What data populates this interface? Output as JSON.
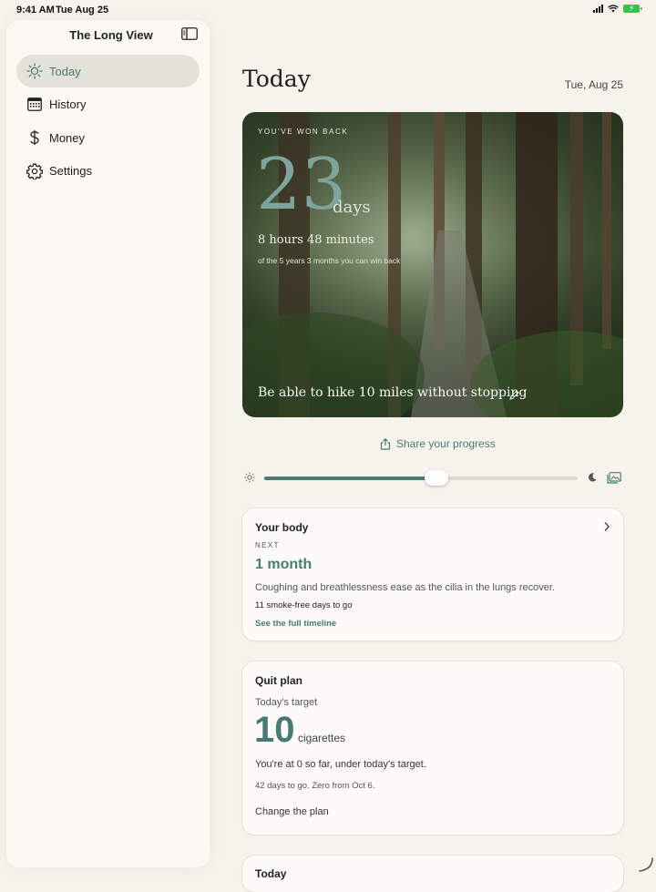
{
  "status_bar": {
    "time": "9:41 AM",
    "date": "Tue Aug 25"
  },
  "sidebar": {
    "app_title": "The Long View",
    "items": [
      {
        "label": "Today",
        "icon": "sun-icon",
        "active": true
      },
      {
        "label": "History",
        "icon": "calendar-icon",
        "active": false
      },
      {
        "label": "Money",
        "icon": "dollar-icon",
        "active": false
      },
      {
        "label": "Settings",
        "icon": "gear-icon",
        "active": false
      }
    ]
  },
  "main": {
    "title": "Today",
    "date": "Tue, Aug 25",
    "hero": {
      "kicker": "YOU'VE WON BACK",
      "number": "23",
      "unit": "days",
      "sub": "8 hours 48 minutes",
      "note": "of the 5 years 3 months you can win back",
      "goal": "Be able to hike 10 miles without stopping"
    },
    "share_label": "Share your progress",
    "brightness_level": 0.55,
    "body_card": {
      "title": "Your body",
      "next_label": "NEXT",
      "milestone": "1 month",
      "description": "Coughing and breathlessness ease as the cilia in the lungs recover.",
      "count": "11 smoke-free days to go",
      "link": "See the full timeline"
    },
    "plan_card": {
      "title": "Quit plan",
      "target_label": "Today's target",
      "target_value": "10",
      "target_unit": "cigarettes",
      "status": "You're at 0 so far, under today's target.",
      "detail": "42 days to go. Zero from Oct 6.",
      "change_label": "Change the plan"
    },
    "today_card": {
      "title": "Today"
    }
  },
  "colors": {
    "accent": "#4a7a74",
    "background": "#f6f3ec",
    "sidebar": "#faf8f2"
  }
}
